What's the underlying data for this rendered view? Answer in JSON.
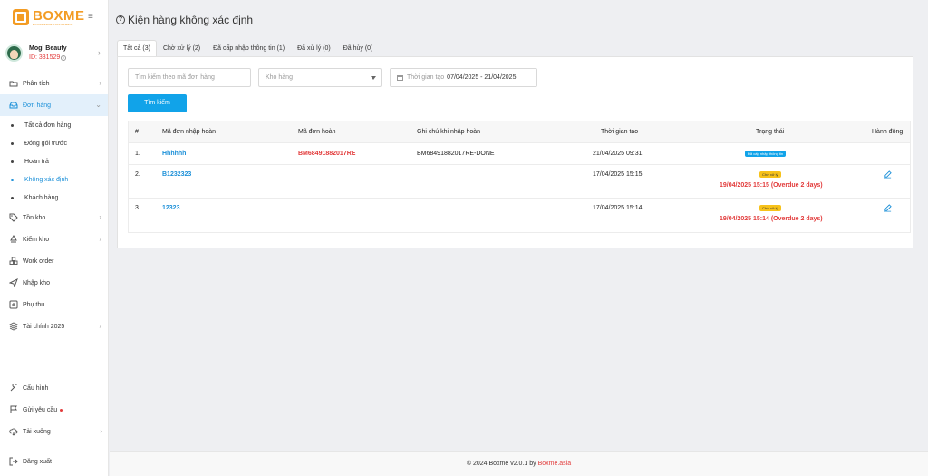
{
  "app": {
    "logo_text": "BOXME",
    "logo_tagline": "ECOMMERCE FULFILLMENT"
  },
  "user": {
    "name": "Mogi Beauty",
    "id": "ID: 331529"
  },
  "sidebar": {
    "items": [
      {
        "label": "Phân tích",
        "icon": "chart-icon"
      },
      {
        "label": "Đơn hàng",
        "icon": "inbox-icon"
      },
      {
        "label": "Tồn kho",
        "icon": "tag-icon"
      },
      {
        "label": "Kiểm kho",
        "icon": "recycle-icon"
      },
      {
        "label": "Work order",
        "icon": "cubes-icon"
      },
      {
        "label": "Nhập kho",
        "icon": "plane-icon"
      },
      {
        "label": "Phụ thu",
        "icon": "plus-square-icon"
      },
      {
        "label": "Tài chính 2025",
        "icon": "layers-icon"
      }
    ],
    "sub_items": [
      {
        "label": "Tất cả đơn hàng"
      },
      {
        "label": "Đóng gói trước"
      },
      {
        "label": "Hoàn trả"
      },
      {
        "label": "Không xác định"
      },
      {
        "label": "Khách hàng"
      }
    ],
    "bottom_items": [
      {
        "label": "Cấu hình",
        "icon": "wrench-icon"
      },
      {
        "label": "Gửi yêu cầu",
        "icon": "flag-icon"
      },
      {
        "label": "Tải xuống",
        "icon": "cloud-download-icon"
      },
      {
        "label": "Đăng xuất",
        "icon": "logout-icon"
      }
    ]
  },
  "page": {
    "title": "Kiện hàng không xác định"
  },
  "tabs": [
    {
      "label": "Tất cả (3)",
      "active": true
    },
    {
      "label": "Chờ xử lý (2)"
    },
    {
      "label": "Đã cấp nhập thông tin (1)"
    },
    {
      "label": "Đã xử lý (0)"
    },
    {
      "label": "Đã hủy (0)"
    }
  ],
  "filters": {
    "search_placeholder": "Tìm kiếm theo mã đơn hàng",
    "warehouse_placeholder": "Kho hàng",
    "date_label": "Thời gian tạo",
    "date_value": "07/04/2025 - 21/04/2025",
    "search_button": "Tìm kiếm"
  },
  "table": {
    "headers": [
      "#",
      "Mã đơn nhập hoàn",
      "Mã đơn hoàn",
      "Ghi chú khi nhập hoàn",
      "Thời gian tạo",
      "Trạng thái",
      "Hành động"
    ],
    "rows": [
      {
        "index": "1.",
        "return_code": "Hhhhhh",
        "order_code": "BM68491882017RE",
        "note": "BM68491882017RE-DONE",
        "created": "21/04/2025 09:31",
        "status": "Đã cấp nhập thông tin",
        "status_type": "info",
        "overdue": ""
      },
      {
        "index": "2.",
        "return_code": "B1232323",
        "order_code": "",
        "note": "",
        "created": "17/04/2025 15:15",
        "status": "Chờ xử lý",
        "status_type": "pending",
        "overdue": "19/04/2025 15:15 (Overdue 2 days)"
      },
      {
        "index": "3.",
        "return_code": "12323",
        "order_code": "",
        "note": "",
        "created": "17/04/2025 15:14",
        "status": "Chờ xử lý",
        "status_type": "pending",
        "overdue": "19/04/2025 15:14 (Overdue 2 days)"
      }
    ]
  },
  "footer": {
    "copyright": "© 2024 Boxme v2.0.1 by ",
    "link": "Boxme.asia"
  },
  "colors": {
    "accent": "#11a3e9",
    "brand": "#f39c24",
    "danger": "#e23b3b",
    "warning": "#f7c21a"
  }
}
